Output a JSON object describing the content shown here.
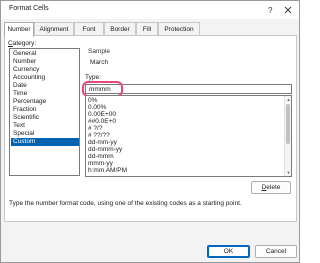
{
  "window": {
    "title": "Format Cells",
    "help_glyph": "?",
    "close_icon": "close-icon"
  },
  "tabs": [
    {
      "label": "Number",
      "active": true
    },
    {
      "label": "Alignment",
      "active": false
    },
    {
      "label": "Font",
      "active": false
    },
    {
      "label": "Border",
      "active": false
    },
    {
      "label": "Fill",
      "active": false
    },
    {
      "label": "Protection",
      "active": false
    }
  ],
  "category": {
    "label": "Category:",
    "items": [
      "General",
      "Number",
      "Currency",
      "Accounting",
      "Date",
      "Time",
      "Percentage",
      "Fraction",
      "Scientific",
      "Text",
      "Special",
      "Custom"
    ],
    "selected": "Custom"
  },
  "sample": {
    "label": "Sample",
    "value": "March"
  },
  "type": {
    "label": "Type:",
    "value": "mmmm",
    "highlight_color": "#e8467c"
  },
  "formats": [
    "0%",
    "0.00%",
    "0.00E+00",
    "##0.0E+0",
    "# ?/?",
    "# ??/??",
    "dd-mm-yy",
    "dd-mmm-yy",
    "dd-mmm",
    "mmm-yy",
    "h:mm AM/PM"
  ],
  "delete_button": {
    "underlined": "D",
    "rest": "elete"
  },
  "hint": "Type the number format code, using one of the existing codes as a starting point.",
  "buttons": {
    "ok": "OK",
    "cancel": "Cancel"
  },
  "colors": {
    "selection": "#0063b1",
    "ok_border": "#0067c0"
  }
}
